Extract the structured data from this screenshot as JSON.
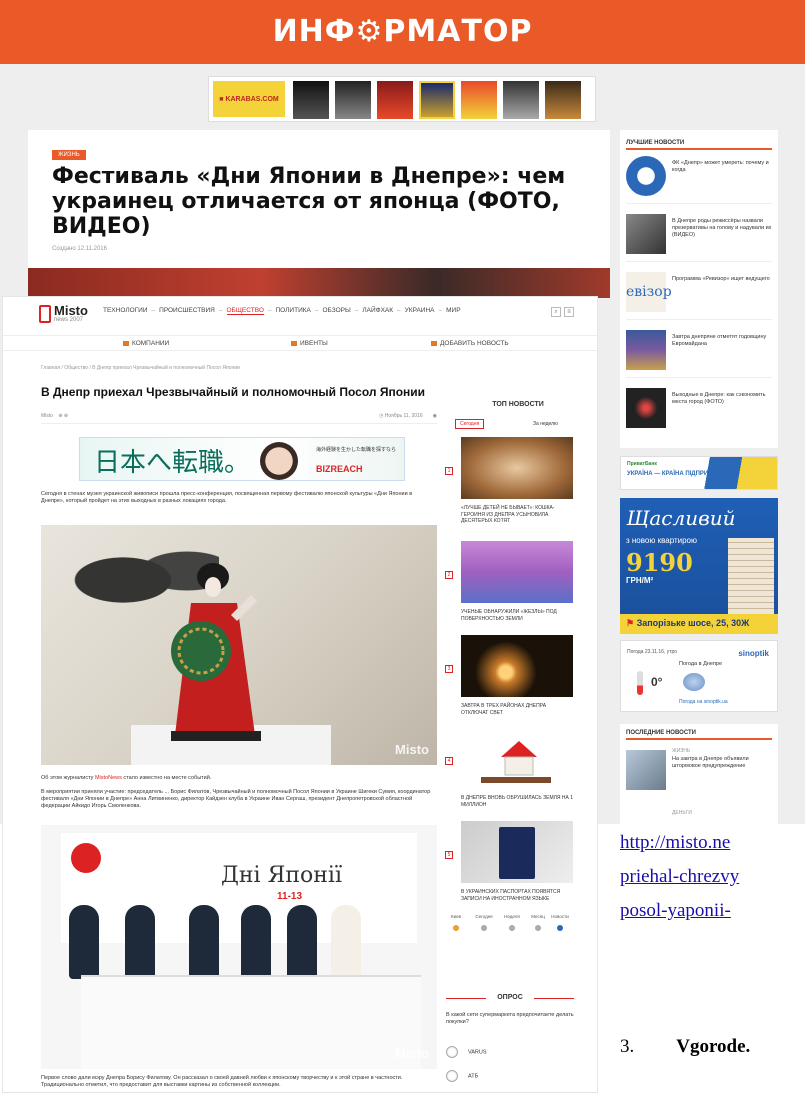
{
  "informator": {
    "logo": "ИНФ⚙РМАТОР",
    "karabas_label": "■ KARABAS.COM",
    "tag": "ЖИЗНЬ",
    "headline": "Фестиваль «Дни Японии в Днепре»: чем украинец отличается от японца (ФОТО, ВИДЕО)",
    "date": "Создано 12.11.2016",
    "sidebar_heading": "ЛУЧШИЕ НОВОСТИ",
    "sidebar_news": [
      "ФК «Днепр» может умереть: почему и когда",
      "В Днепре роды режиссёры назвали презервативы на голову и надували их (ВИДЕО)",
      "Программа «Ревизор» ищет ведущего",
      "Завтра днепряне отметят годовщину Евромайдана",
      "Выходные в Днепре: как сэкономить места город (ФОТО)"
    ],
    "ua_banner_top": "ПриватБанк",
    "ua_banner_text": "УКРАЇНА — КРАЇНА ПІДПРИЄМЦІВ",
    "promo": {
      "title": "Щасливий",
      "subtitle": "з новою квартирою",
      "price": "9190",
      "unit": "ГРН/М²",
      "address": "Запорізьке шосе, 25, 30Ж"
    },
    "weather": {
      "logo": "sinoptik",
      "top": "Погода 23.11.16, утро",
      "title": "Погода в Днепре",
      "temp": "0°",
      "foot": "Погода на sinoptik.ua"
    },
    "last_heading": "ПОСЛЕДНИЕ НОВОСТИ",
    "last_cat": "ЖИЗНЬ",
    "last_text": "На завтра в Днепре объявили штормовое предупреждение",
    "last_cat2": "ДЕНЬГИ"
  },
  "misto": {
    "logo_name": "Misto",
    "logo_sub": "news 2007",
    "nav": [
      "ТЕХНОЛОГИИ",
      "ПРОИСШЕСТВИЯ",
      "ОБЩЕСТВО",
      "ПОЛИТИКА",
      "ОБЗОРЫ",
      "ЛАЙФХАК",
      "УКРАИНА",
      "МИР"
    ],
    "subnav": [
      "КОМПАНИИ",
      "ИВЕНТЫ",
      "ДОБАВИТЬ НОВОСТЬ"
    ],
    "crumb": "Главная / Общество / В Днепр приехал Чрезвычайный и полномочный Посол Японии",
    "title": "В Днепр приехал Чрезвычайный и полномочный Посол Японии",
    "meta_left": "Misto",
    "meta_right": "Ноябрь 11, 2016",
    "ad_jp": "日本へ転職。",
    "ad_small": "海外経験を生かした転職を探すなら",
    "ad_brand": "BIZREACH",
    "lead": "Сегодня в стенах музея украинской живописи прошла пресс-конференция, посвященная первому фестивалю японской культуры «Дни Японии в Днепре», который пройдет на этих выходных в разных локациях города.",
    "watermark": "Misto",
    "cap1_pre": "Об этом журналисту ",
    "cap1_hl": "MistoNews",
    "cap1_post": " стало известно на месте событий.",
    "para2": "В мероприятии приняли участие: председатель ... Борис Филатов, Чрезвычайный и полномочный Посол Японии в Украине Шигеки Сумия, координатор фестиваля «Дни Японии в Днепре» Анна Литвиненко, директор Кайдзен клуба в Украине Иван Сергаш, президент Днепропетровской областной федерации Айкидо Игорь Смоленкова.",
    "banner_title": "Дні Японії",
    "banner_date": "11-13",
    "foot": "Первое слово дали мэру Днепра Борису Филатову. Он рассказал о своей давней любви к японскому творчеству и к этой стране в частности. Традиционально отметил, что предоставит для выставки картины из собственной коллекции.",
    "side_heading": "ТОП НОВОСТИ",
    "side_tabs": [
      "Сегодня",
      "За неделю"
    ],
    "side_items": [
      {
        "num": "1",
        "cap": "«ЛУЧШЕ ДЕТЕЙ НЕ БЫВАЕТ»: КОШКА-ГЕРОИНЯ ИЗ ДНЕПРА УСЫНОВИЛА ДЕСЯТЕРЫХ КОТЯТ"
      },
      {
        "num": "2",
        "cap": "УЧЕНЫЕ ОБНАРУЖИЛИ «ЖЕЗЛЫ» ПОД ПОВЕРХНОСТЬЮ ЗЕМЛИ"
      },
      {
        "num": "3",
        "cap": "ЗАВТРА В ТРЕХ РАЙОНАХ ДНЕПРА ОТКЛЮЧАТ СВЕТ"
      },
      {
        "num": "4",
        "cap": "В ДНЕПРЕ ВНОВЬ ОБРУШИЛАСЬ ЗЕМЛЯ НА 1 МИЛЛИОН"
      },
      {
        "num": "5",
        "cap": "В УКРАИНСКИХ ПАСПОРТАХ ПОЯВЯТСЯ ЗАПИСИ НА ИНОСТРАННОМ ЯЗЫКЕ"
      }
    ],
    "poll_icons": [
      "Киев",
      "Сегодня",
      "Неделя",
      "Месяц",
      "Новости"
    ],
    "poll_heading": "ОПРОС",
    "poll_question": "В какой сети супермаркета предпочитаете делать покупки?",
    "poll_options": [
      "VARUS",
      "АТБ"
    ]
  },
  "document": {
    "link_lines": [
      "http://misto.ne",
      "priehal-chrezvy",
      "posol-yaponii-"
    ],
    "item_number": "3.",
    "item_text": "Vgorode."
  }
}
